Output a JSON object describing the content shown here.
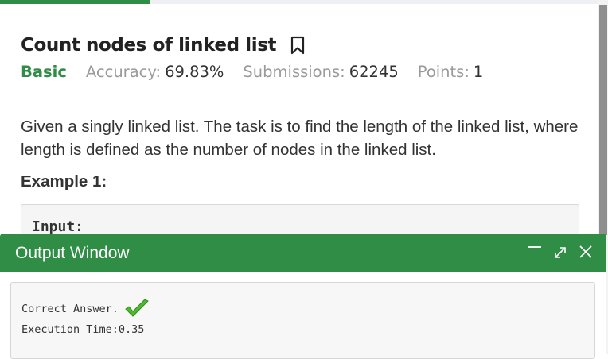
{
  "progress": {
    "fraction": 0.25,
    "color": "#2f8d46"
  },
  "problem": {
    "title": "Count nodes of linked list",
    "difficulty": "Basic",
    "accuracy_label": "Accuracy:",
    "accuracy_value": "69.83%",
    "submissions_label": "Submissions:",
    "submissions_value": "62245",
    "points_label": "Points:",
    "points_value": "1",
    "statement": "Given a singly linked list. The task is to find the length of the linked list, where length is defined as the number of nodes in the linked list.",
    "example_heading": "Example 1:",
    "input_label": "Input:"
  },
  "output_window": {
    "title": "Output Window",
    "result_text": "Correct Answer.",
    "execution_time": "Execution Time:0.35"
  },
  "colors": {
    "brand": "#2f8d46",
    "check": "#4fb92c"
  },
  "icons": [
    "bookmark-icon",
    "minimize-icon",
    "expand-icon",
    "close-icon",
    "check-icon"
  ]
}
